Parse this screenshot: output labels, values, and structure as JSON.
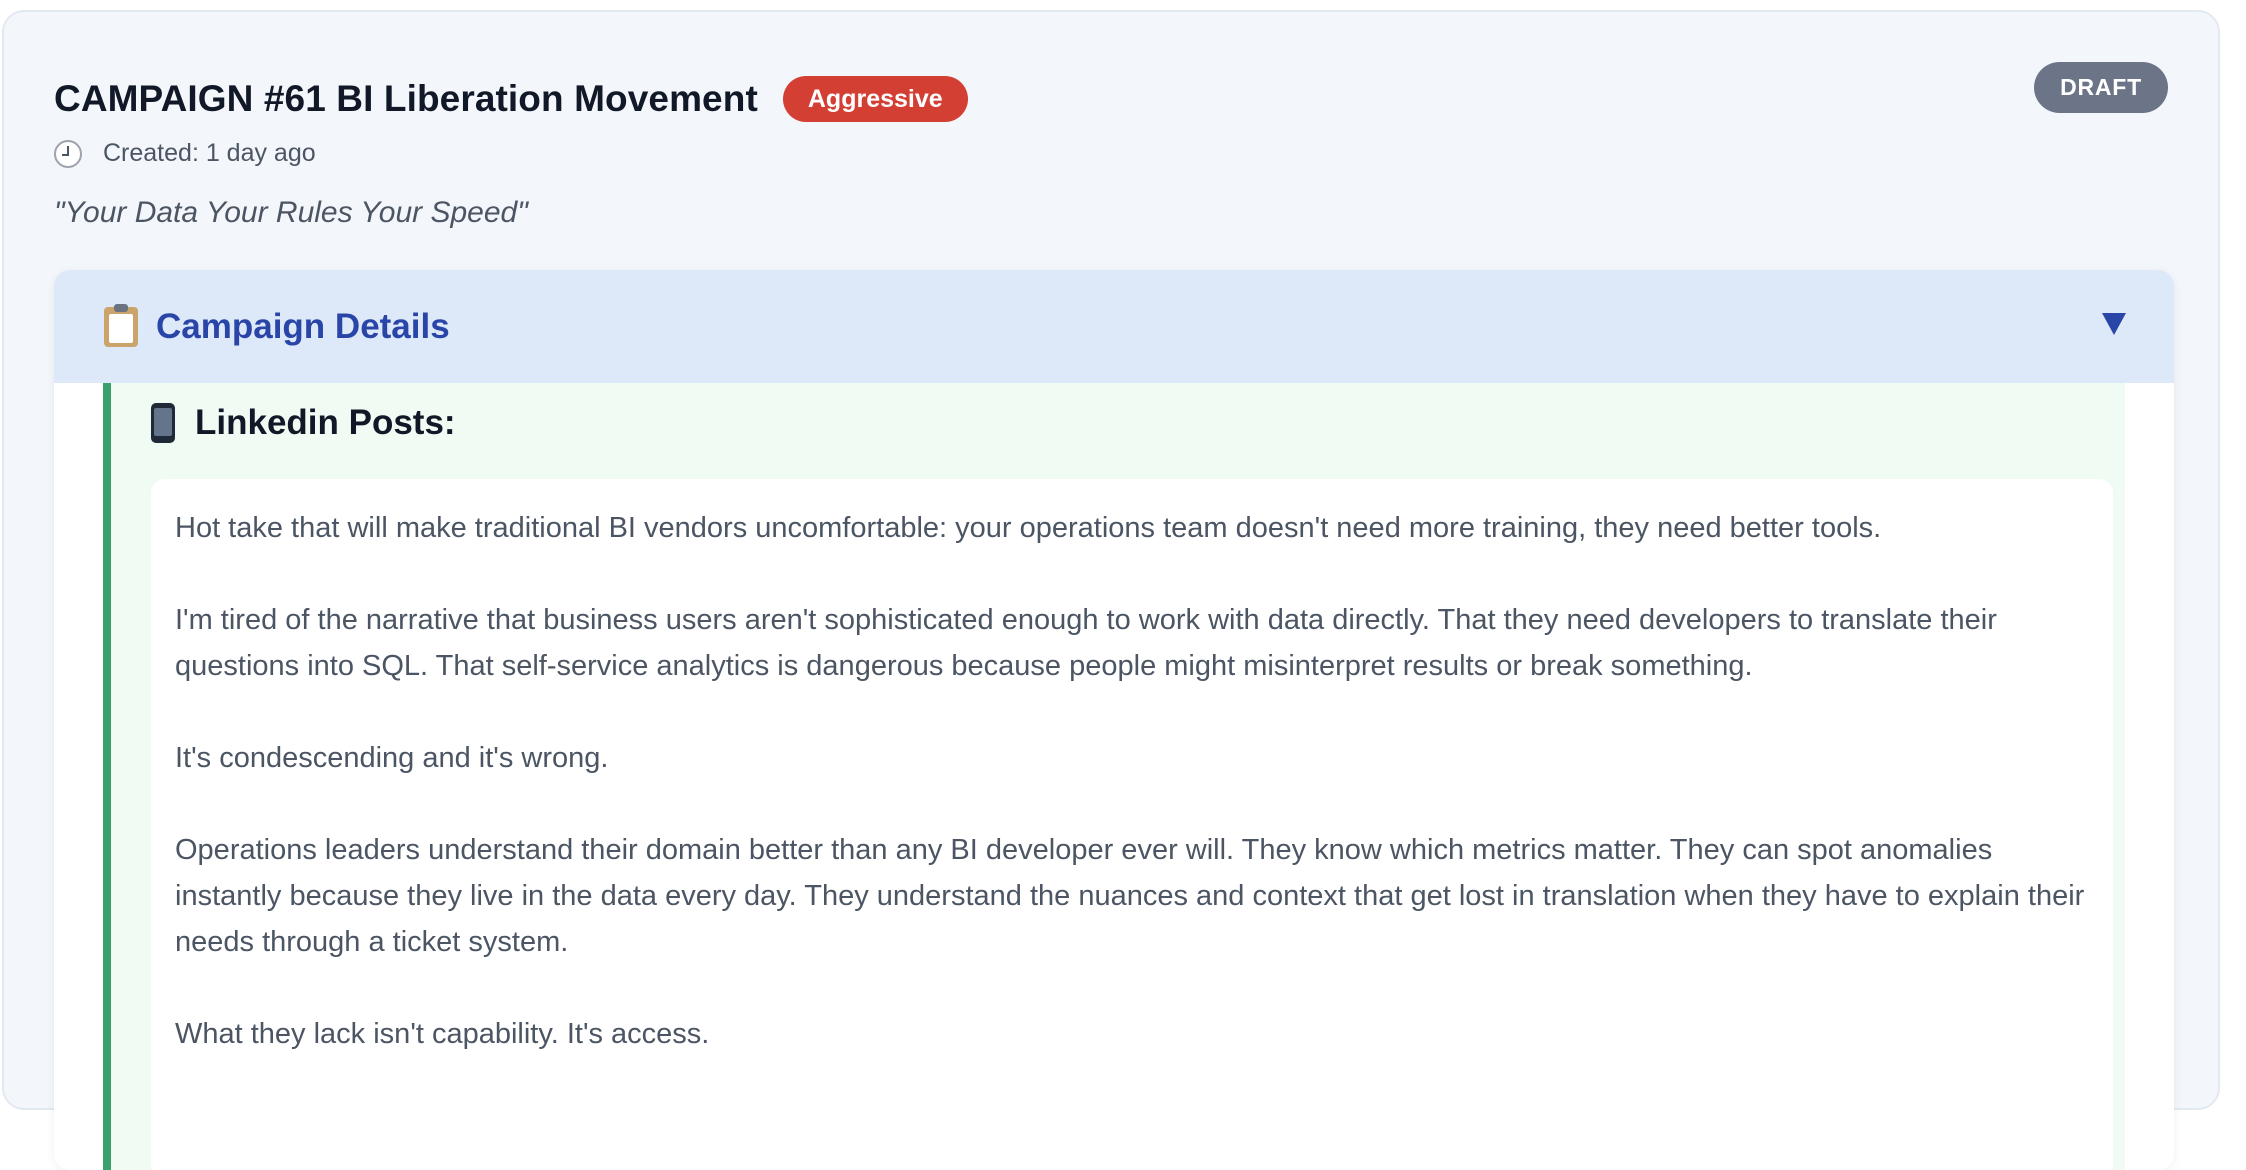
{
  "campaign": {
    "title": "CAMPAIGN #61 BI Liberation Movement",
    "tone_badge": "Aggressive",
    "status": "DRAFT",
    "created": "Created: 1 day ago",
    "slogan": "\"Your Data Your Rules Your Speed\""
  },
  "details": {
    "title": "Campaign Details",
    "icon": "clipboard-icon",
    "toggle_icon": "chevron-down-icon",
    "section": {
      "title": "Linkedin Posts:",
      "icon": "phone-icon",
      "paragraphs": [
        "Hot take that will make traditional BI vendors uncomfortable: your operations team doesn't need more training, they need better tools.",
        "I'm tired of the narrative that business users aren't sophisticated enough to work with data directly. That they need developers to translate their questions into SQL. That self-service analytics is dangerous because people might misinterpret results or break something.",
        "It's condescending and it's wrong.",
        "Operations leaders understand their domain better than any BI developer ever will. They know which metrics matter. They can spot anomalies instantly because they live in the data every day. They understand the nuances and context that get lost in translation when they have to explain their needs through a ticket system.",
        "What they lack isn't capability. It's access."
      ]
    }
  },
  "colors": {
    "badge_red": "#d43f33",
    "draft_gray": "#6b7587",
    "accent_blue": "#2a45a8",
    "green_bar": "#3aa06d"
  }
}
